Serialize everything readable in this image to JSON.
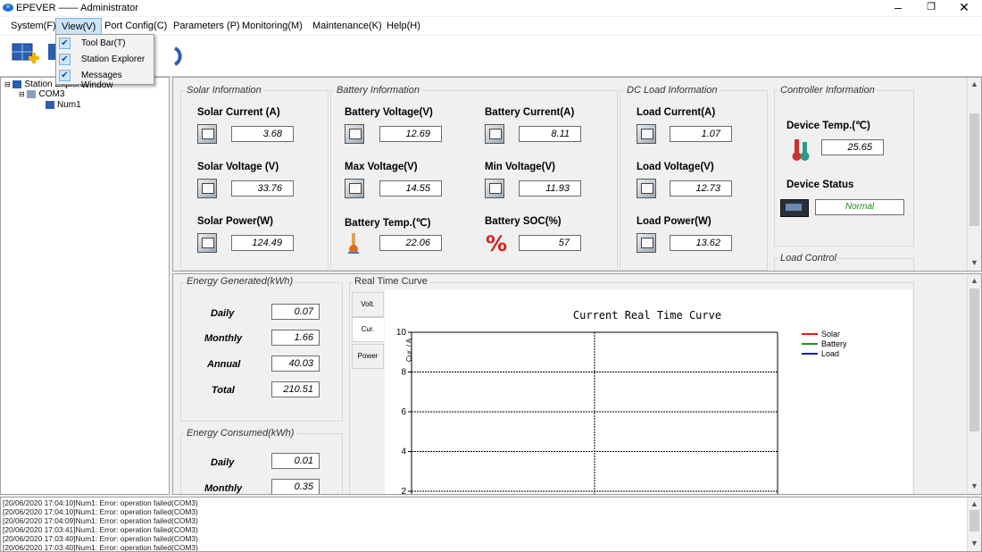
{
  "window": {
    "title": "EPEVER —— Administrator",
    "logo_text": "EPEVER"
  },
  "menu": {
    "items": [
      "System(F)",
      "View(V)",
      "Port Config(C)",
      "Parameters (P)",
      "Monitoring(M)",
      "Maintenance(K)",
      "Help(H)"
    ]
  },
  "view_menu": {
    "items": [
      {
        "label": "Tool Bar(T)",
        "checked": true
      },
      {
        "label": "Station Explorer",
        "checked": true
      },
      {
        "label": "Messages Window",
        "checked": true
      }
    ]
  },
  "tree": {
    "root": "Station Explorer",
    "port": "COM3",
    "device": "Num1"
  },
  "solar": {
    "group_title": "Solar Information",
    "current_label": "Solar Current (A)",
    "current": "3.68",
    "voltage_label": "Solar Voltage (V)",
    "voltage": "33.76",
    "power_label": "Solar Power(W)",
    "power": "124.49"
  },
  "battery": {
    "group_title": "Battery Information",
    "voltage_label": "Battery Voltage(V)",
    "voltage": "12.69",
    "current_label": "Battery Current(A)",
    "current": "8.11",
    "max_label": "Max Voltage(V)",
    "max": "14.55",
    "min_label": "Min Voltage(V)",
    "min": "11.93",
    "temp_label": "Battery Temp.(℃)",
    "temp": "22.06",
    "soc_label": "Battery SOC(%)",
    "soc": "57"
  },
  "load": {
    "group_title": "DC Load Information",
    "current_label": "Load Current(A)",
    "current": "1.07",
    "voltage_label": "Load Voltage(V)",
    "voltage": "12.73",
    "power_label": "Load Power(W)",
    "power": "13.62"
  },
  "controller": {
    "group_title": "Controller Information",
    "temp_label": "Device Temp.(℃)",
    "temp": "25.65",
    "status_label": "Device Status",
    "status": "Normal",
    "status_color": "#1a8a1a",
    "load_control_title": "Load Control"
  },
  "energy_generated": {
    "title": "Energy Generated(kWh)",
    "rows": [
      {
        "label": "Daily",
        "value": "0.07"
      },
      {
        "label": "Monthly",
        "value": "1.66"
      },
      {
        "label": "Annual",
        "value": "40.03"
      },
      {
        "label": "Total",
        "value": "210.51"
      }
    ]
  },
  "energy_consumed": {
    "title": "Energy Consumed(kWh)",
    "rows": [
      {
        "label": "Daily",
        "value": "0.01"
      },
      {
        "label": "Monthly",
        "value": "0.35"
      }
    ]
  },
  "curve": {
    "group_title": "Real Time Curve",
    "tabs": [
      "Volt.",
      "Cur.",
      "Power"
    ],
    "active_tab": "Cur."
  },
  "chart_data": {
    "type": "line",
    "title": "Current Real Time Curve",
    "xlabel": "",
    "ylabel": "Cur. / A",
    "yticks": [
      "10",
      "8",
      "6",
      "4",
      "2"
    ],
    "ylim": [
      2,
      10
    ],
    "grid": true,
    "legend_position": "top-right",
    "series": [
      {
        "name": "Solar",
        "color": "#e81818",
        "values": []
      },
      {
        "name": "Battery",
        "color": "#1a9a1a",
        "values": []
      },
      {
        "name": "Load",
        "color": "#1a1ab0",
        "values": []
      }
    ]
  },
  "messages": [
    "[20/06/2020 17:04:10]Num1: Error: operation failed(COM3)",
    "[20/06/2020 17:04:10]Num1: Error: operation failed(COM3)",
    "[20/06/2020 17:04:09]Num1: Error: operation failed(COM3)",
    "[20/06/2020 17:03:41]Num1: Error: operation failed(COM3)",
    "[20/06/2020 17:03:40]Num1: Error: operation failed(COM3)",
    "[20/06/2020 17:03:40]Num1: Error: operation failed(COM3)"
  ]
}
